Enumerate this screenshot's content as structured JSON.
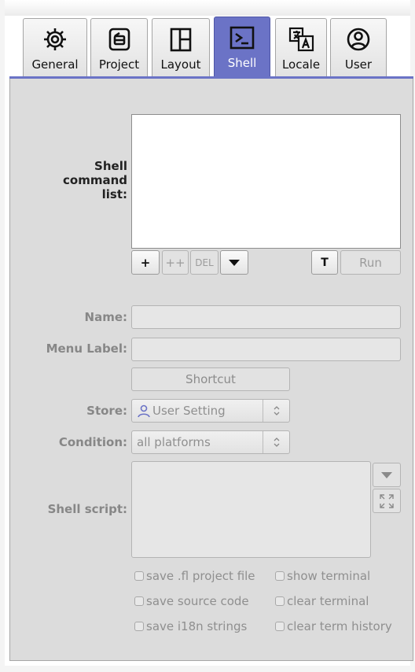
{
  "tabs": [
    {
      "label": "General",
      "icon": "gear-icon"
    },
    {
      "label": "Project",
      "icon": "project-icon"
    },
    {
      "label": "Layout",
      "icon": "layout-icon"
    },
    {
      "label": "Shell",
      "icon": "terminal-icon",
      "active": true
    },
    {
      "label": "Locale",
      "icon": "translate-icon"
    },
    {
      "label": "User",
      "icon": "user-icon"
    }
  ],
  "shell": {
    "list_label": "Shell command list:",
    "list_items": [],
    "buttons": {
      "add": "+",
      "add_dup": "++",
      "delete": "DEL",
      "terminal": "T",
      "run": "Run"
    },
    "name_label": "Name:",
    "name_value": "",
    "menu_label_label": "Menu Label:",
    "menu_label_value": "",
    "shortcut": "Shortcut",
    "store_label": "Store:",
    "store_value": "User Setting",
    "condition_label": "Condition:",
    "condition_value": "all platforms",
    "script_label": "Shell script:",
    "script_value": "",
    "options": {
      "save_fl": "save .fl project file",
      "show_terminal": "show terminal",
      "save_source": "save source code",
      "clear_terminal": "clear terminal",
      "save_i18n": "save i18n strings",
      "clear_history": "clear term history"
    }
  },
  "colors": {
    "accent": "#6b73c6",
    "panel": "#dcdcdc"
  }
}
